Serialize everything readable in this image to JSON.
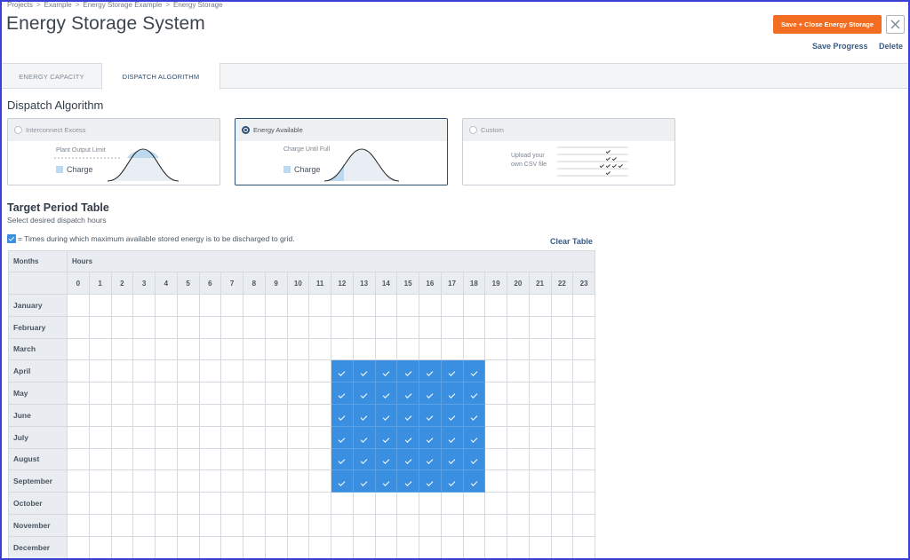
{
  "breadcrumb": [
    "Projects",
    "Example",
    "Energy Storage Example",
    "Energy Storage"
  ],
  "title": "Energy Storage System",
  "actions": {
    "save_close": "Save + Close Energy Storage",
    "save_progress": "Save Progress",
    "delete": "Delete"
  },
  "tabs": [
    "ENERGY CAPACITY",
    "DISPATCH ALGORITHM"
  ],
  "active_tab": "DISPATCH ALGORITHM",
  "section_title": "Dispatch Algorithm",
  "options": [
    {
      "label": "Interconnect Excess",
      "selected": false,
      "caption": "Plant Output Limit",
      "charge": "Charge"
    },
    {
      "label": "Energy Available",
      "selected": true,
      "caption": "Charge Until Full",
      "charge": "Charge"
    },
    {
      "label": "Custom",
      "selected": false,
      "caption_line1": "Upload your",
      "caption_line2": "own CSV file"
    }
  ],
  "target_period": {
    "title": "Target Period Table",
    "subtitle": "Select desired dispatch hours",
    "legend": "= Times during which maximum available stored energy is to be discharged to grid.",
    "clear": "Clear Table",
    "months_header": "Months",
    "hours_header": "Hours",
    "hours": [
      "0",
      "1",
      "2",
      "3",
      "4",
      "5",
      "6",
      "7",
      "8",
      "9",
      "10",
      "11",
      "12",
      "13",
      "14",
      "15",
      "16",
      "17",
      "18",
      "19",
      "20",
      "21",
      "22",
      "23"
    ],
    "months": [
      "January",
      "February",
      "March",
      "April",
      "May",
      "June",
      "July",
      "August",
      "September",
      "October",
      "November",
      "December"
    ],
    "selected_months": [
      "April",
      "May",
      "June",
      "July",
      "August",
      "September"
    ],
    "selected_hours": [
      "12",
      "13",
      "14",
      "15",
      "16",
      "17",
      "18"
    ]
  },
  "colors": {
    "accent_orange": "#f26d21",
    "selected_blue": "#3b8fe0",
    "link_navy": "#3a5a80"
  }
}
